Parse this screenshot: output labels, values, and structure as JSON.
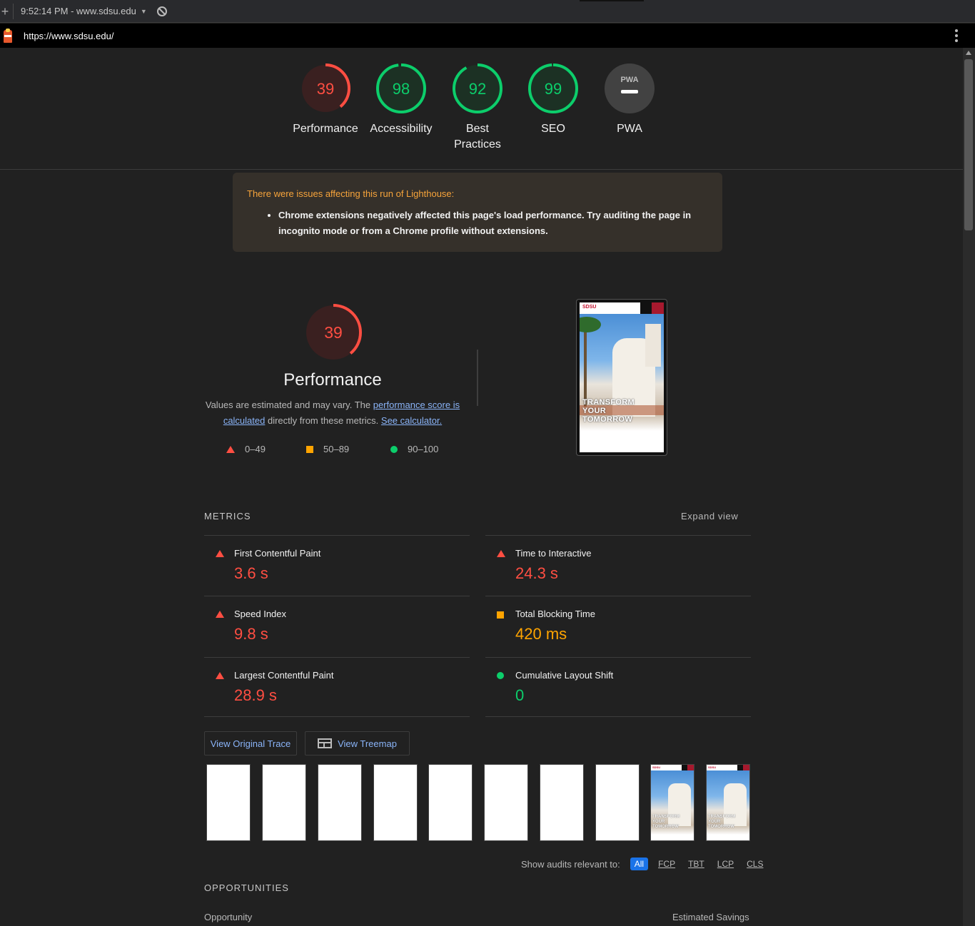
{
  "topbar": {
    "run_label": "9:52:14 PM - www.sdsu.edu"
  },
  "urlbar": {
    "url": "https://www.sdsu.edu/"
  },
  "gauges": [
    {
      "score": "39",
      "label": "Performance",
      "color": "#ff4e42",
      "bg": "#3a2020",
      "fraction": 0.39
    },
    {
      "score": "98",
      "label": "Accessibility",
      "color": "#0cce6b",
      "bg": "#1c3124",
      "fraction": 0.98
    },
    {
      "score": "92",
      "label": "Best Practices",
      "color": "#0cce6b",
      "bg": "#1c3124",
      "fraction": 0.92
    },
    {
      "score": "99",
      "label": "SEO",
      "color": "#0cce6b",
      "bg": "#1c3124",
      "fraction": 0.99
    },
    {
      "score": "PWA",
      "label": "PWA",
      "color": "#9e9e9e",
      "bg": "#424242",
      "fraction": 0
    }
  ],
  "warning": {
    "title": "There were issues affecting this run of Lighthouse:",
    "item": "Chrome extensions negatively affected this page's load performance. Try auditing the page in incognito mode or from a Chrome profile without extensions."
  },
  "performance": {
    "score": "39",
    "fraction": 0.39,
    "title": "Performance",
    "desc_1": "Values are estimated and may vary. The ",
    "link_1": "performance score is calculated",
    "desc_2": " directly from these metrics. ",
    "link_2": "See calculator.",
    "legend": [
      "0–49",
      "50–89",
      "90–100"
    ]
  },
  "screenshot": {
    "logo": "SDSU",
    "hero": [
      "TRANSFORM",
      "YOUR",
      "TOMORROW"
    ]
  },
  "metrics": {
    "heading": "METRICS",
    "expand": "Expand view",
    "items": [
      {
        "name": "First Contentful Paint",
        "value": "3.6 s",
        "rating": "red"
      },
      {
        "name": "Time to Interactive",
        "value": "24.3 s",
        "rating": "red"
      },
      {
        "name": "Speed Index",
        "value": "9.8 s",
        "rating": "red"
      },
      {
        "name": "Total Blocking Time",
        "value": "420 ms",
        "rating": "orange"
      },
      {
        "name": "Largest Contentful Paint",
        "value": "28.9 s",
        "rating": "red"
      },
      {
        "name": "Cumulative Layout Shift",
        "value": "0",
        "rating": "green"
      }
    ]
  },
  "buttons": {
    "trace": "View Original Trace",
    "treemap": "View Treemap"
  },
  "filmstrip": {
    "frames": [
      "blank",
      "blank",
      "blank",
      "blank",
      "blank",
      "blank",
      "blank",
      "blank",
      "page",
      "page"
    ],
    "mini_text": [
      "TRANSFORM",
      "YOUR",
      "TOMORROW"
    ]
  },
  "audits_filter": {
    "label": "Show audits relevant to:",
    "chips": [
      "All",
      "FCP",
      "TBT",
      "LCP",
      "CLS"
    ],
    "active": "All"
  },
  "opportunities": {
    "heading": "OPPORTUNITIES",
    "col_left": "Opportunity",
    "col_right": "Estimated Savings"
  }
}
